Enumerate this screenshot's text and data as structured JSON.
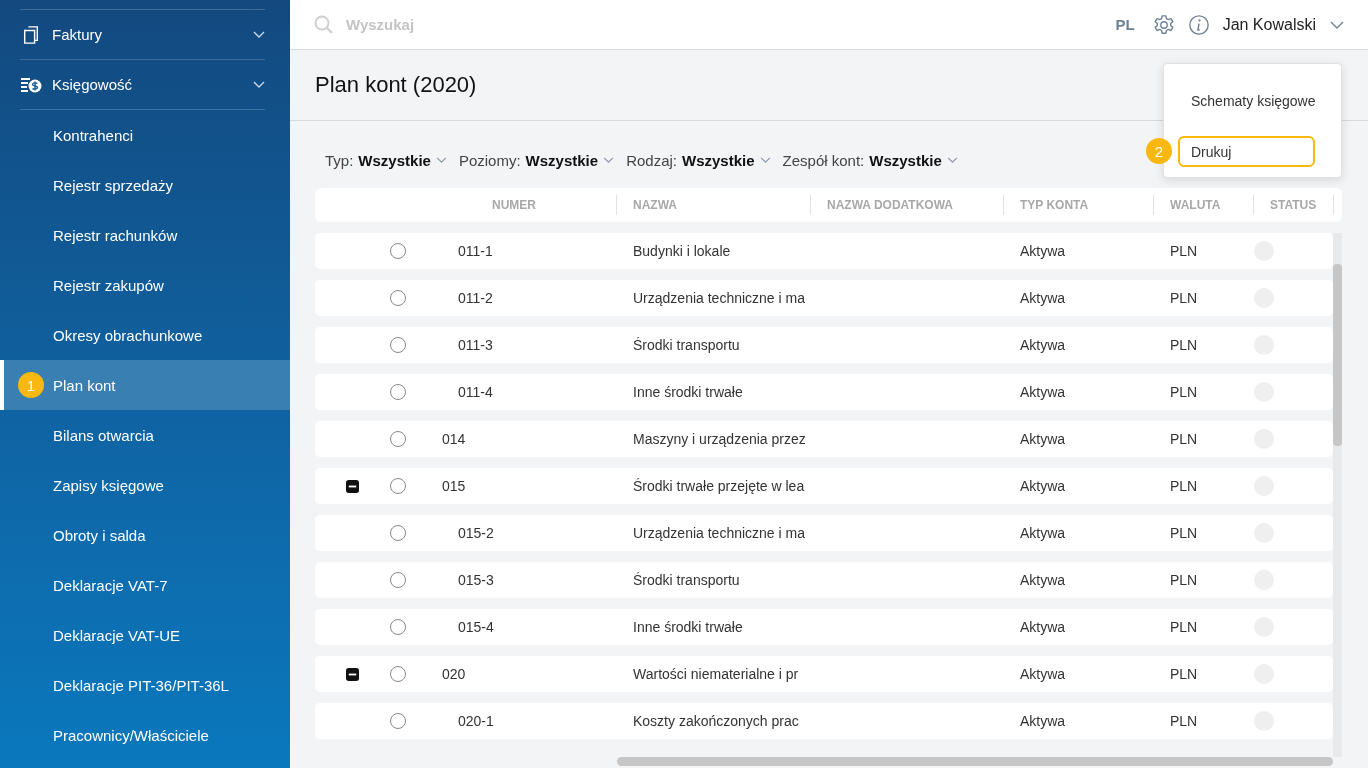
{
  "sidebar": {
    "sections": [
      {
        "label": "Faktury"
      },
      {
        "label": "Księgowość",
        "expanded": true,
        "children": [
          {
            "label": "Kontrahenci",
            "selected": false
          },
          {
            "label": "Rejestr sprzedaży",
            "selected": false
          },
          {
            "label": "Rejestr rachunków",
            "selected": false
          },
          {
            "label": "Rejestr zakupów",
            "selected": false
          },
          {
            "label": "Okresy obrachunkowe",
            "selected": false
          },
          {
            "label": "Plan kont",
            "selected": true,
            "badge": "1"
          },
          {
            "label": "Bilans otwarcia",
            "selected": false
          },
          {
            "label": "Zapisy księgowe",
            "selected": false
          },
          {
            "label": "Obroty i salda",
            "selected": false
          },
          {
            "label": "Deklaracje VAT-7",
            "selected": false
          },
          {
            "label": "Deklaracje VAT-UE",
            "selected": false
          },
          {
            "label": "Deklaracje PIT-36/PIT-36L",
            "selected": false
          },
          {
            "label": "Pracownicy/Właściciele",
            "selected": false
          }
        ]
      }
    ]
  },
  "topbar": {
    "search": {
      "placeholder": "Wyszukaj"
    },
    "language": "PL",
    "user": "Jan Kowalski"
  },
  "page": {
    "title": "Plan kont (2020)"
  },
  "filters": [
    {
      "label": "Typ:",
      "value": "Wszystkie"
    },
    {
      "label": "Poziomy:",
      "value": "Wszystkie"
    },
    {
      "label": "Rodzaj:",
      "value": "Wszystkie"
    },
    {
      "label": "Zespół kont:",
      "value": "Wszystkie"
    }
  ],
  "menu": {
    "items": [
      {
        "label": "Schematy księgowe",
        "selected": false
      },
      {
        "label": "Drukuj",
        "selected": true,
        "badge": "2"
      }
    ]
  },
  "table": {
    "columns": [
      "NUMER",
      "NAZWA",
      "NAZWA DODATKOWA",
      "TYP KONTA",
      "WALUTA",
      "STATUS"
    ],
    "rows": [
      {
        "children": [
          {
            "numer": "011-1",
            "nazwa": "Budynki i lokale",
            "typ": "Aktywa",
            "waluta": "PLN",
            "selected": false
          },
          {
            "numer": "011-2",
            "nazwa": "Urządzenia techniczne i ma",
            "typ": "Aktywa",
            "waluta": "PLN",
            "selected": false
          },
          {
            "numer": "011-3",
            "nazwa": "Środki transportu",
            "typ": "Aktywa",
            "waluta": "PLN",
            "selected": false
          },
          {
            "numer": "011-4",
            "nazwa": "Inne środki trwałe",
            "typ": "Aktywa",
            "waluta": "PLN",
            "selected": false
          }
        ]
      },
      {
        "numer": "014",
        "nazwa": "Maszyny i urządzenia przez",
        "typ": "Aktywa",
        "waluta": "PLN",
        "selected": false
      },
      {
        "numer": "015",
        "nazwa": "Środki trwałe przejęte w lea",
        "typ": "Aktywa",
        "waluta": "PLN",
        "selected": false,
        "expanded": true,
        "children": [
          {
            "numer": "015-2",
            "nazwa": "Urządzenia techniczne i ma",
            "typ": "Aktywa",
            "waluta": "PLN",
            "selected": false
          },
          {
            "numer": "015-3",
            "nazwa": "Środki transportu",
            "typ": "Aktywa",
            "waluta": "PLN",
            "selected": false
          },
          {
            "numer": "015-4",
            "nazwa": "Inne środki trwałe",
            "typ": "Aktywa",
            "waluta": "PLN",
            "selected": false
          }
        ]
      },
      {
        "numer": "020",
        "nazwa": "Wartości niematerialne i pr",
        "typ": "Aktywa",
        "waluta": "PLN",
        "selected": false,
        "expanded": true,
        "children": [
          {
            "numer": "020-1",
            "nazwa": "Koszty zakończonych prac",
            "typ": "Aktywa",
            "waluta": "PLN",
            "selected": false
          }
        ]
      }
    ]
  }
}
